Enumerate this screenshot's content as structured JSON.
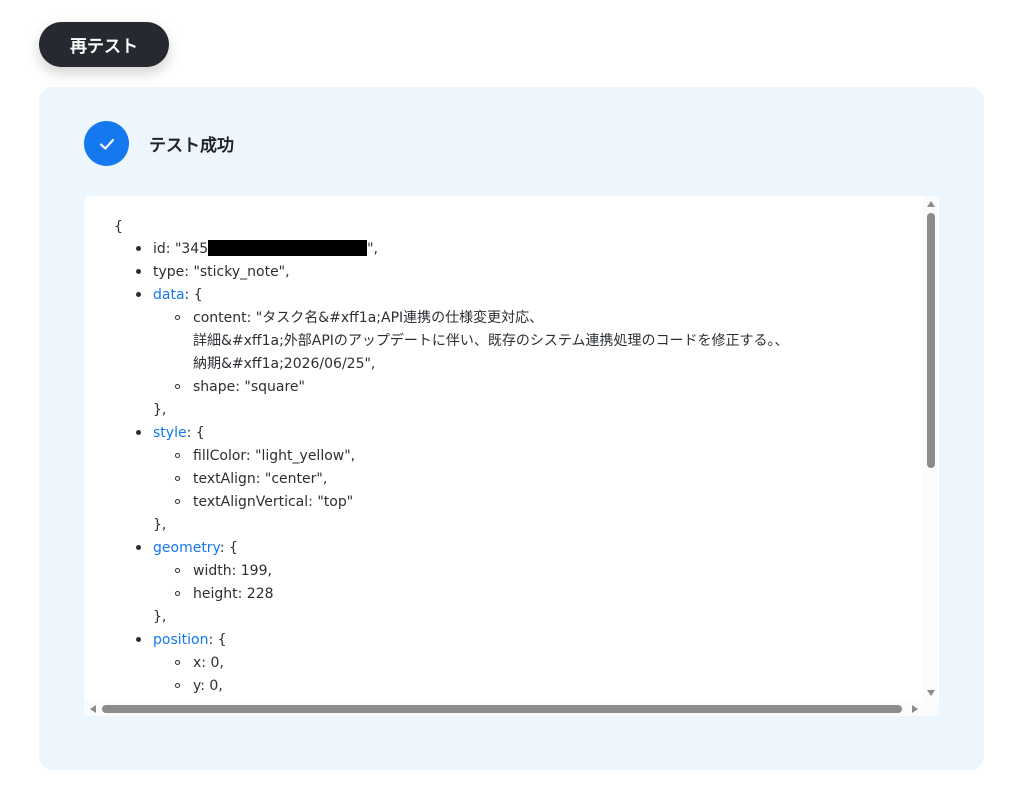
{
  "header": {
    "retest_label": "再テスト"
  },
  "result": {
    "status_icon": "check-icon",
    "title": "テスト成功"
  },
  "json_view": {
    "open_brace": "{",
    "id_prefix": "id: \"345",
    "id_suffix": "\",",
    "type_line": "type: \"sticky_note\",",
    "data_key": "data",
    "data_open": ": {",
    "content_line1": "content: \"タスク名&#xff1a;API連携の仕様変更対応、",
    "content_line2": "詳細&#xff1a;外部APIのアップデートに伴い、既存のシステム連携処理のコードを修正する。、",
    "content_line3": "納期&#xff1a;2026/06/25\",",
    "shape_line": "shape: \"square\"",
    "data_close": "},",
    "style_key": "style",
    "style_open": ": {",
    "fill_color_line": "fillColor: \"light_yellow\",",
    "text_align_line": "textAlign: \"center\",",
    "text_align_vertical_line": "textAlignVertical: \"top\"",
    "style_close": "},",
    "geometry_key": "geometry",
    "geometry_open": ": {",
    "width_line": "width: 199,",
    "height_line": "height: 228",
    "geometry_close": "},",
    "position_key": "position",
    "position_open": ": {",
    "x_line": "x: 0,",
    "y_line": "y: 0,"
  },
  "colors": {
    "accent": "#1478ee",
    "button_bg": "#262a30",
    "panel_bg": "#eef6fd",
    "redaction": "#000000"
  }
}
